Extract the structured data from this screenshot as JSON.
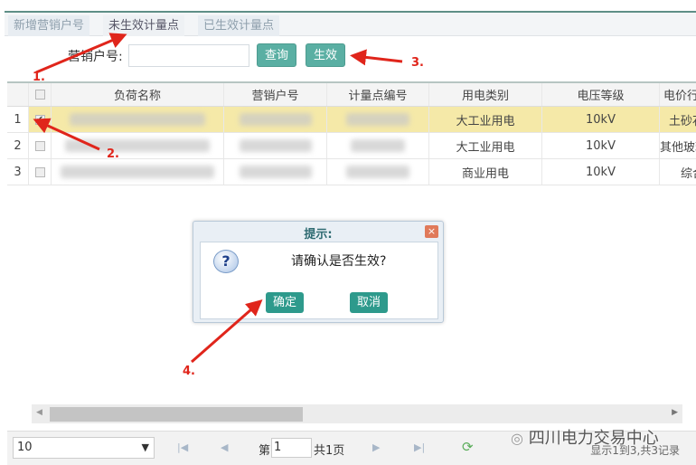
{
  "tabs": [
    {
      "label": "新增营销户号"
    },
    {
      "label": "未生效计量点"
    },
    {
      "label": "已生效计量点"
    }
  ],
  "search": {
    "label": "营销户号:",
    "value": "",
    "query_button": "查询",
    "apply_button": "生效"
  },
  "table": {
    "headers": [
      "负荷名称",
      "营销户号",
      "计量点编号",
      "用电类别",
      "电压等级",
      "电价行"
    ],
    "rows": [
      {
        "num": "1",
        "checked": true,
        "name": "",
        "account": "",
        "meter": "",
        "category": "大工业用电",
        "voltage": "10kV",
        "price": "土砂石"
      },
      {
        "num": "2",
        "checked": false,
        "name": "",
        "account": "",
        "meter": "",
        "category": "大工业用电",
        "voltage": "10kV",
        "price": "其他玻璃"
      },
      {
        "num": "3",
        "checked": false,
        "name": "",
        "account": "",
        "meter": "",
        "category": "商业用电",
        "voltage": "10kV",
        "price": "综合"
      }
    ]
  },
  "pager": {
    "page_size": "10",
    "page_prefix": "第",
    "page": "1",
    "page_total": "共1页",
    "summary": "显示1到3,共3记录"
  },
  "dialog": {
    "title": "提示:",
    "message": "请确认是否生效?",
    "ok": "确定",
    "cancel": "取消",
    "close": "×"
  },
  "annotations": [
    "1.",
    "2.",
    "3.",
    "4."
  ],
  "watermark": "四川电力交易中心",
  "colors": {
    "accent": "#5aafa3",
    "selected_row": "#f5e9a8",
    "arrow": "#e0251b"
  }
}
